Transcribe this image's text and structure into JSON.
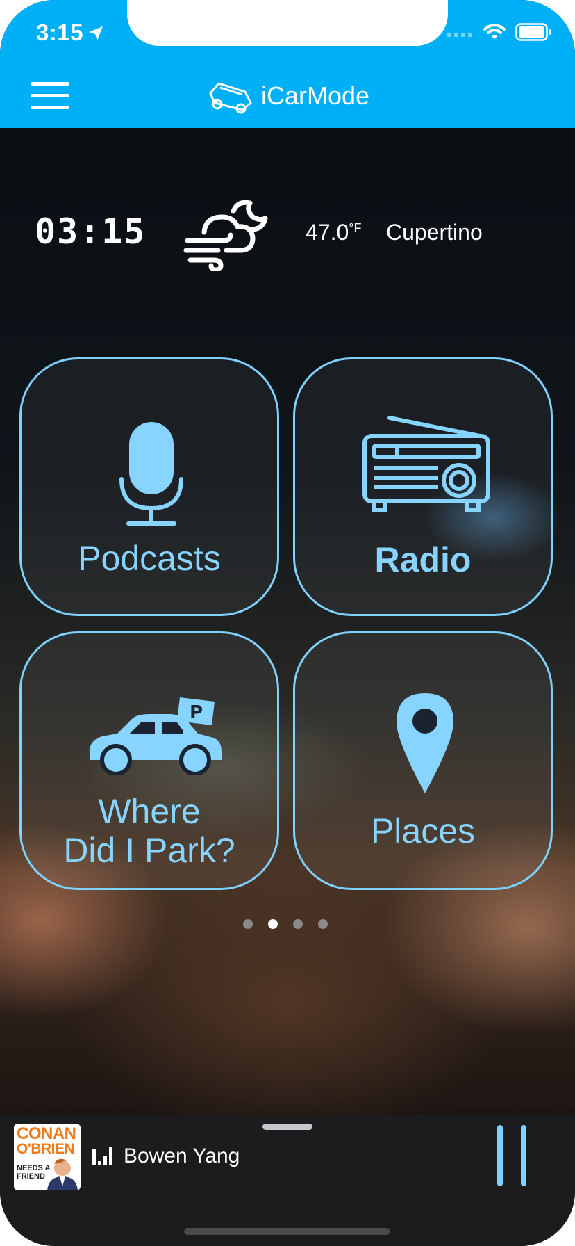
{
  "status_bar": {
    "time": "3:15"
  },
  "header": {
    "title": "iCarMode"
  },
  "dashboard": {
    "clock": "03:15",
    "temperature": "47.0",
    "temperature_unit": "°F",
    "city": "Cupertino"
  },
  "tiles": [
    {
      "label": "Podcasts",
      "icon": "microphone-icon"
    },
    {
      "label": "Radio",
      "icon": "radio-icon"
    },
    {
      "label_line1": "Where",
      "label_line2": "Did I Park?",
      "icon": "parked-car-icon"
    },
    {
      "label": "Places",
      "icon": "map-pin-icon"
    }
  ],
  "page_indicator": {
    "count": 4,
    "active_index": 1
  },
  "now_playing": {
    "title": "Bowen Yang",
    "cover": {
      "line1": "CONAN",
      "line2": "O'BRIEN",
      "line3": "NEEDS A",
      "line4": "FRIEND"
    }
  },
  "colors": {
    "accent": "#00b0f6",
    "tile_outline": "#7fd1ff",
    "player_bg": "#1c1c1e"
  }
}
